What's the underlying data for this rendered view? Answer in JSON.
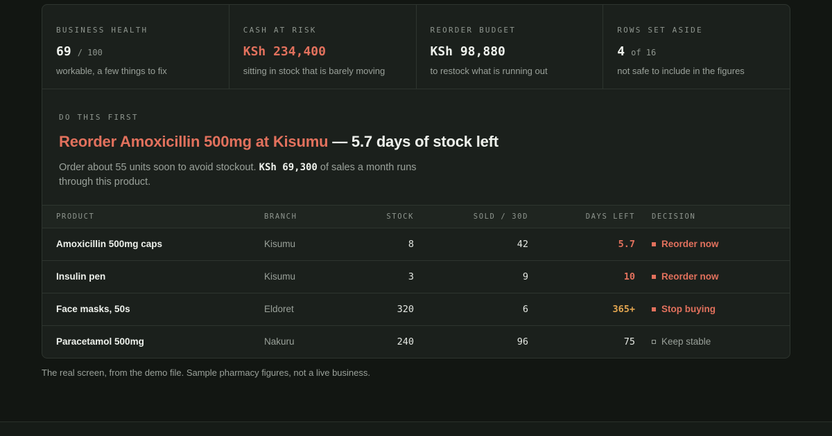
{
  "stats": [
    {
      "label": "BUSINESS HEALTH",
      "value": "69",
      "suffix": "/ 100",
      "desc": "workable, a few things to fix"
    },
    {
      "label": "CASH AT RISK",
      "value": "KSh 234,400",
      "suffix": "",
      "desc": "sitting in stock that is barely moving"
    },
    {
      "label": "REORDER BUDGET",
      "value": "KSh 98,880",
      "suffix": "",
      "desc": "to restock what is running out"
    },
    {
      "label": "ROWS SET ASIDE",
      "value": "4",
      "suffix": "of 16",
      "desc": "not safe to include in the figures"
    }
  ],
  "first": {
    "label": "DO THIS FIRST",
    "title_accent": "Reorder Amoxicillin 500mg at Kisumu",
    "title_rest": " — 5.7 days of stock left",
    "body_before": "Order about 55 units soon to avoid stockout. ",
    "body_money": "KSh 69,300",
    "body_after": " of sales a month runs through this product."
  },
  "table": {
    "headers": {
      "product": "PRODUCT",
      "branch": "BRANCH",
      "stock": "STOCK",
      "sold": "SOLD / 30D",
      "days": "DAYS LEFT",
      "decision": "DECISION"
    },
    "rows": [
      {
        "product": "Amoxicillin 500mg caps",
        "branch": "Kisumu",
        "stock": "8",
        "sold": "42",
        "days": "5.7",
        "decision": "Reorder now"
      },
      {
        "product": "Insulin pen",
        "branch": "Kisumu",
        "stock": "3",
        "sold": "9",
        "days": "10",
        "decision": "Reorder now"
      },
      {
        "product": "Face masks, 50s",
        "branch": "Eldoret",
        "stock": "320",
        "sold": "6",
        "days": "365+",
        "decision": "Stop buying"
      },
      {
        "product": "Paracetamol 500mg",
        "branch": "Nakuru",
        "stock": "240",
        "sold": "96",
        "days": "75",
        "decision": "Keep stable"
      }
    ]
  },
  "caption": "The real screen, from the demo file. Sample pharmacy figures, not a live business.",
  "colors": {
    "accent": "#e2715d",
    "warning": "#e2a550",
    "background": "#121612",
    "card": "#1b201c"
  }
}
